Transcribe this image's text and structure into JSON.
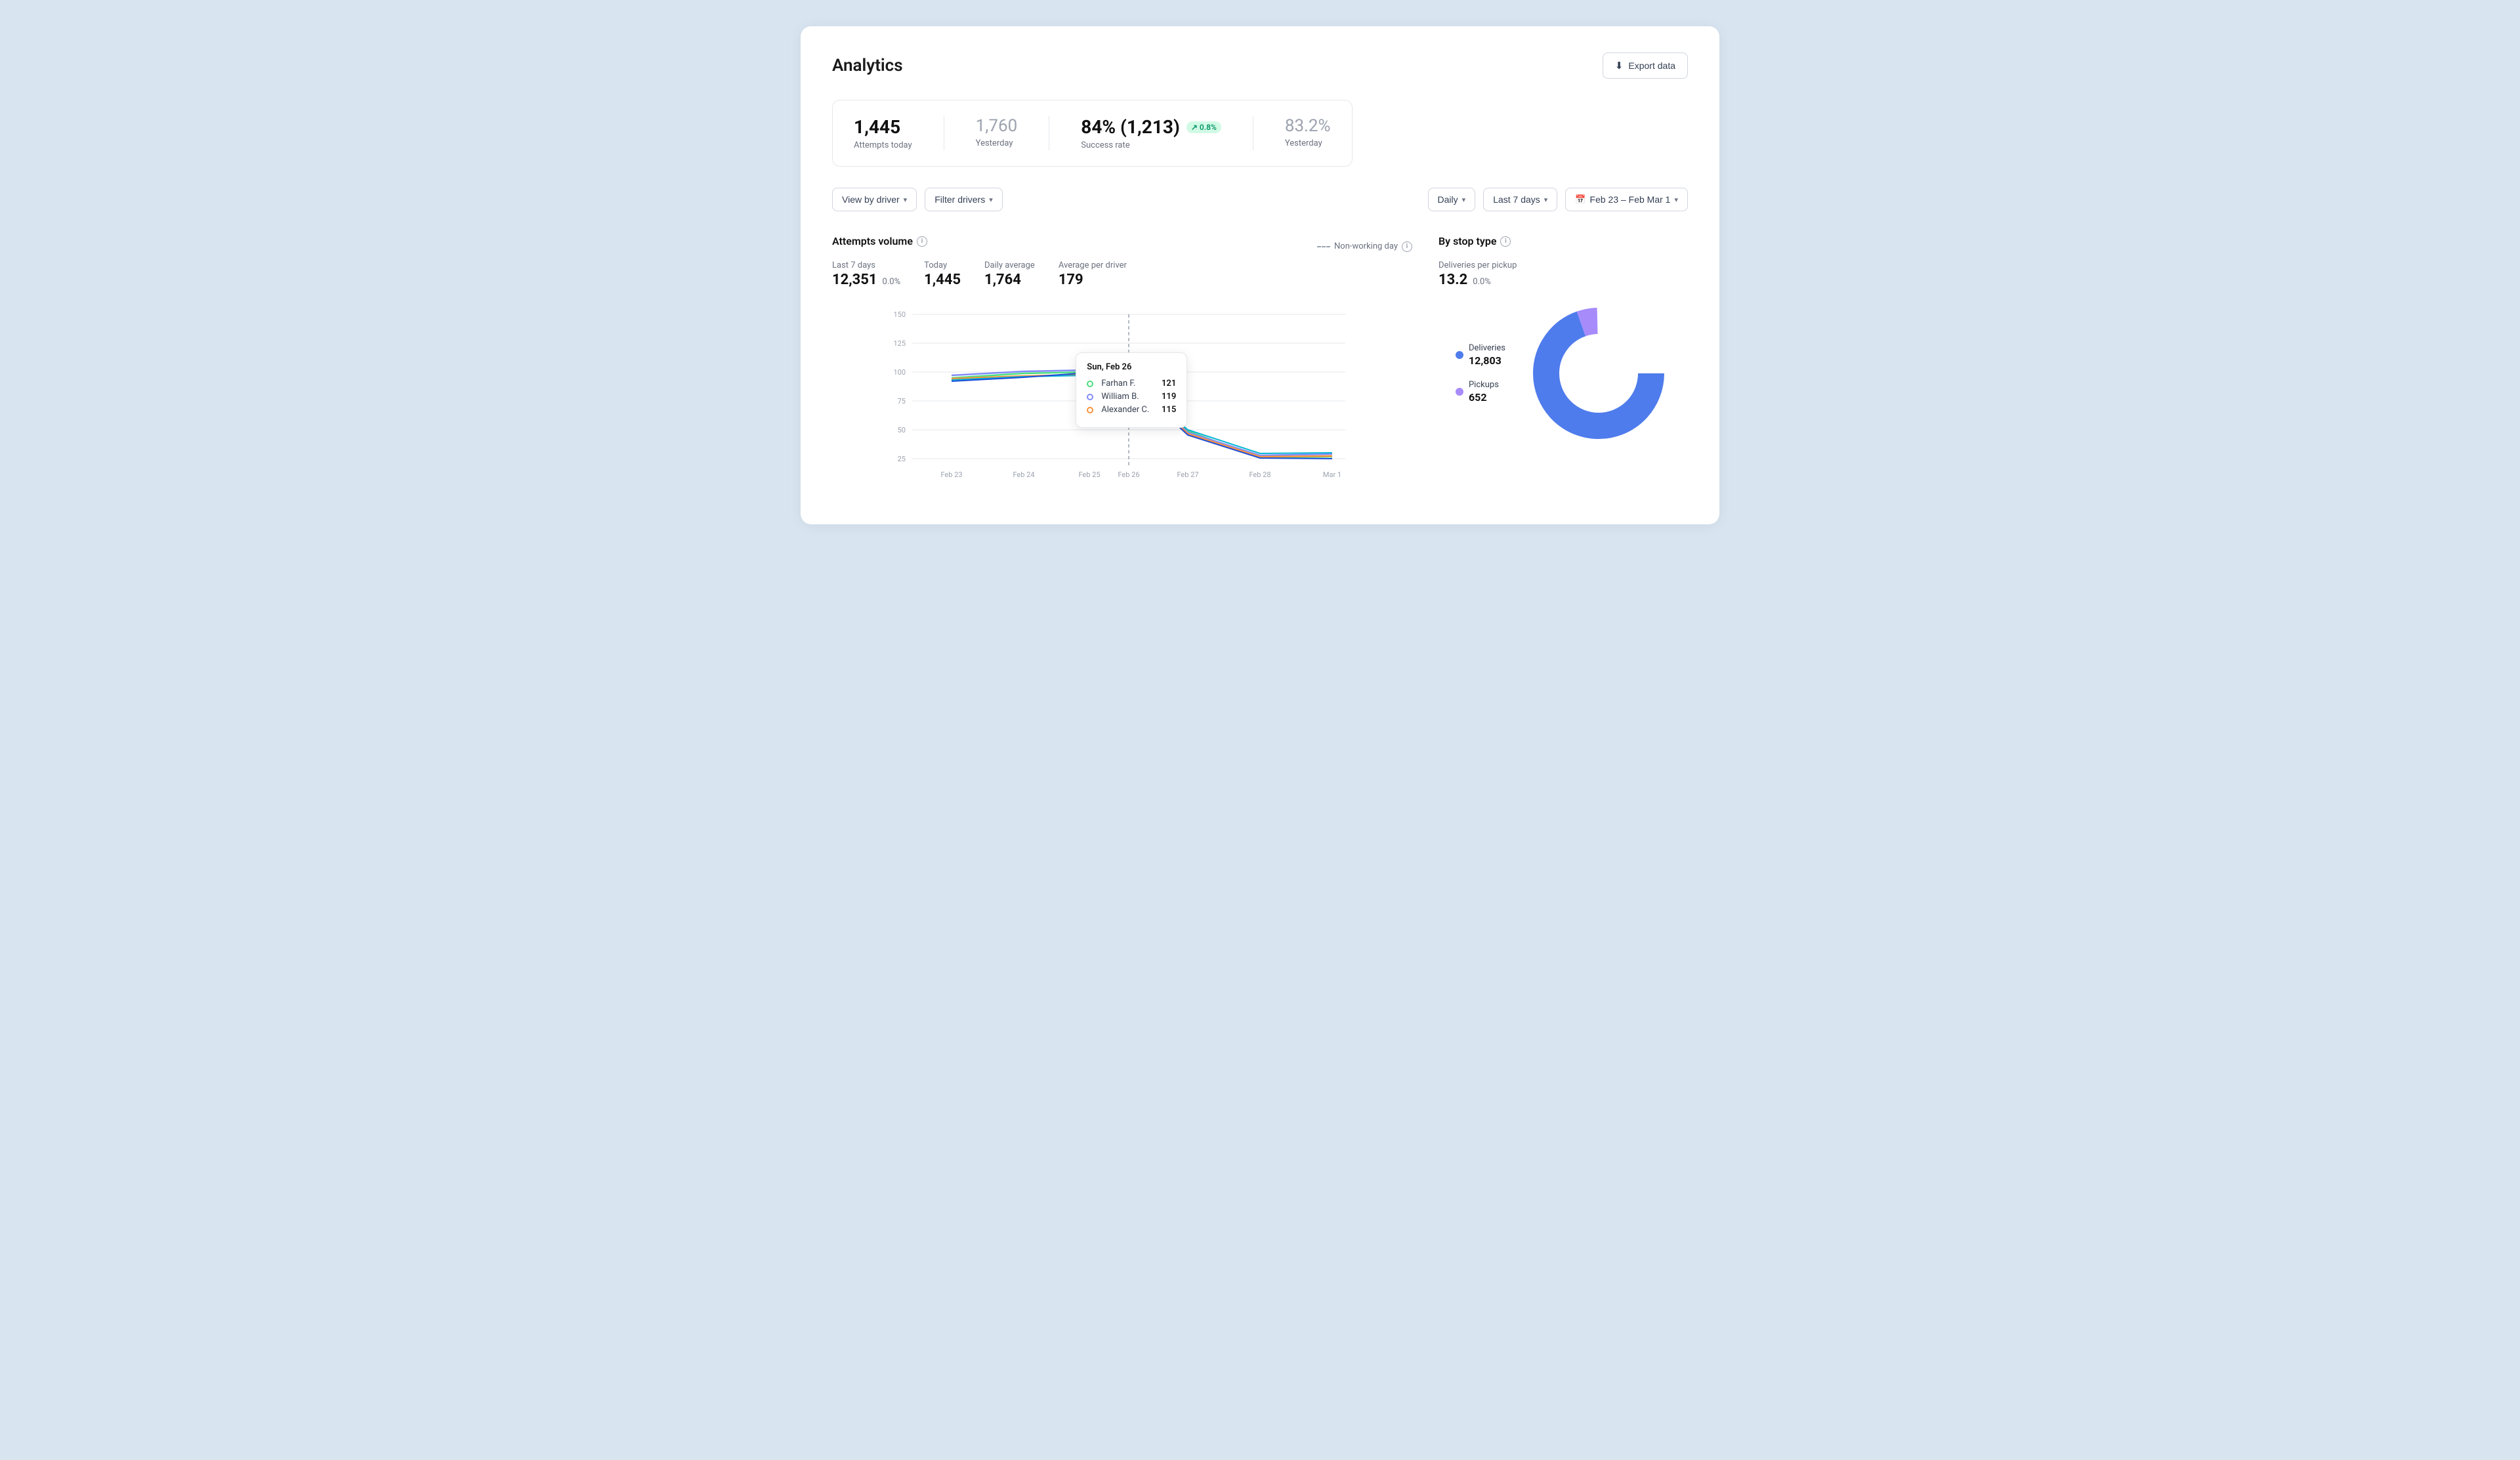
{
  "header": {
    "title": "Analytics",
    "export_label": "Export data"
  },
  "stats": {
    "attempts_today_value": "1,445",
    "attempts_today_label": "Attempts today",
    "yesterday_value": "1,760",
    "yesterday_label": "Yesterday",
    "success_rate_value": "84% (1,213)",
    "success_rate_badge": "↗ 0.8%",
    "success_rate_label": "Success rate",
    "yesterday_pct_value": "83.2%",
    "yesterday_pct_label": "Yesterday"
  },
  "filters": {
    "view_by_driver": "View by driver",
    "filter_drivers": "Filter drivers",
    "daily": "Daily",
    "last_7_days": "Last 7 days",
    "date_range": "Feb 23 – Feb Mar 1"
  },
  "attempts_volume": {
    "section_title": "Attempts volume",
    "non_working_day_label": "Non-working day",
    "last_7_days_label": "Last 7 days",
    "last_7_days_value": "12,351",
    "last_7_days_pct": "0.0%",
    "today_label": "Today",
    "today_value": "1,445",
    "daily_average_label": "Daily average",
    "daily_average_value": "1,764",
    "avg_per_driver_label": "Average per driver",
    "avg_per_driver_value": "179",
    "x_labels": [
      "Feb 23",
      "Feb 24",
      "Feb 25",
      "Feb 26",
      "Feb 27",
      "Feb 28",
      "Mar 1"
    ],
    "y_labels": [
      "150",
      "125",
      "100",
      "75",
      "50",
      "25"
    ],
    "tooltip": {
      "date": "Sun, Feb 26",
      "rows": [
        {
          "name": "Farhan F.",
          "value": "121",
          "color": "#4ade80"
        },
        {
          "name": "William B.",
          "value": "119",
          "color": "#818cf8"
        },
        {
          "name": "Alexander C.",
          "value": "115",
          "color": "#fb923c"
        }
      ]
    }
  },
  "by_stop_type": {
    "section_title": "By stop type",
    "deliveries_per_pickup_label": "Deliveries per pickup",
    "deliveries_per_pickup_value": "13.2",
    "deliveries_per_pickup_pct": "0.0%",
    "legend": [
      {
        "label": "Deliveries",
        "value": "12,803",
        "color": "#4f7cec"
      },
      {
        "label": "Pickups",
        "value": "652",
        "color": "#a78bfa"
      }
    ],
    "donut": {
      "deliveries_pct": 95,
      "pickups_pct": 5
    }
  },
  "icons": {
    "info": "i",
    "chevron_down": "▾",
    "calendar": "📅",
    "download": "⬇"
  }
}
